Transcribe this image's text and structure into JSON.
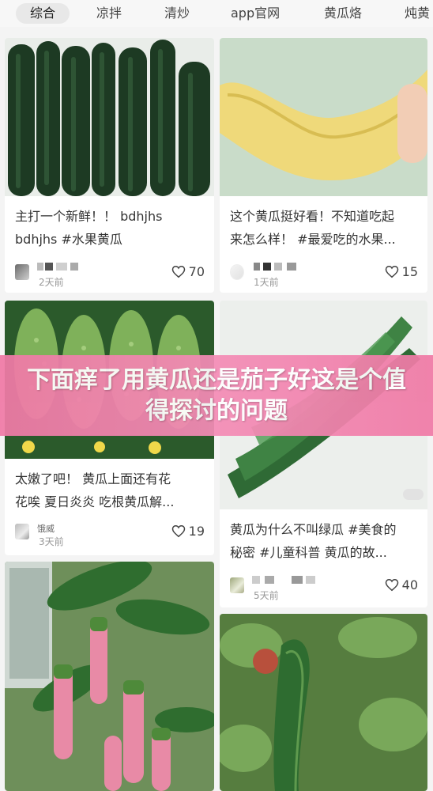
{
  "tabs": [
    "综合",
    "凉拌",
    "清炒",
    "app官网",
    "黄瓜烙",
    "炖黄"
  ],
  "cards": [
    {
      "title": [
        "主打一个新鲜！！ bdhjhs",
        "bdhjhs #水果黄瓜"
      ],
      "time": "2天前",
      "likes": "70"
    },
    {
      "title": [
        "这个黄瓜挺好看！不知道吃起",
        "来怎么样！ #最爱吃的水果..."
      ],
      "time": "1天前",
      "likes": "15"
    },
    {
      "title": [
        "太嫩了吧！ 黄瓜上面还有花",
        "花唉 夏日炎炎 吃根黄瓜解..."
      ],
      "time": "3天前",
      "user_visible": "饿威",
      "likes": "19"
    },
    {
      "title": [
        "黄瓜为什么不叫绿瓜 #美食的",
        "秘密 #儿童科普  黄瓜的故..."
      ],
      "time": "5天前",
      "likes": "40"
    }
  ],
  "banner": {
    "text": "下面痒了用黄瓜还是茄子好这是个值得探讨的问题"
  },
  "colors": {
    "banner": "#f07aa6",
    "tab_active_bg": "#e8e8e8",
    "page_bg": "#f4f4f4"
  }
}
